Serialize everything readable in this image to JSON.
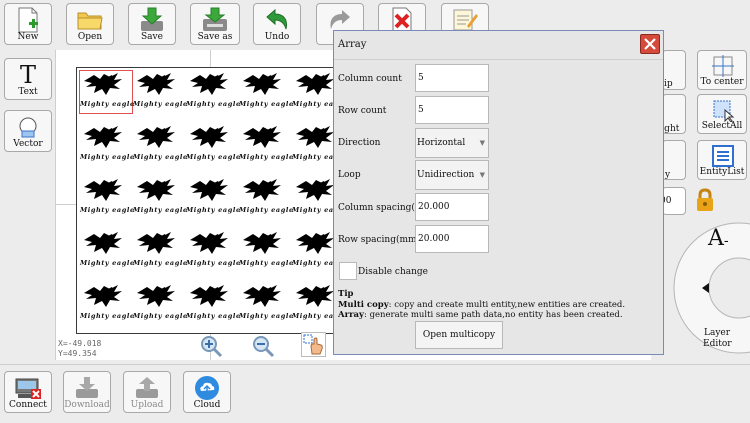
{
  "toolbar": {
    "new": "New",
    "open": "Open",
    "save": "Save",
    "save_as": "Save as",
    "undo": "Undo"
  },
  "left_tools": {
    "text": "Text",
    "vector": "Vector"
  },
  "right_tools": {
    "flip_partial": "ip",
    "to_center": "To center",
    "right_partial": "right",
    "select_all": "SelectAll",
    "y_partial": "y",
    "entity_list": "EntityList",
    "zero_partial": "00",
    "layer_editor_line1": "Layer",
    "layer_editor_line2": "Editor",
    "text_style_glyph": "A"
  },
  "coords": {
    "x": "X=-49.018",
    "y": "Y=49.354"
  },
  "design": {
    "caption": "Mighty eagle",
    "rows": 5,
    "cols": 5
  },
  "dialog": {
    "title": "Array",
    "column_count_label": "Column count",
    "column_count_value": "5",
    "row_count_label": "Row count",
    "row_count_value": "5",
    "direction_label": "Direction",
    "direction_value": "Horizontal",
    "loop_label": "Loop",
    "loop_value": "Unidirection",
    "column_spacing_label": "Column spacing(mm)",
    "column_spacing_value": "20.000",
    "row_spacing_label": "Row spacing(mm)",
    "row_spacing_value": "20.000",
    "disable_change_label": "Disable change",
    "tip_title": "Tip",
    "tip_multi_label": "Multi copy",
    "tip_multi_text": ": copy and create multi entity,new entities are created.",
    "tip_array_label": "Array",
    "tip_array_text": ": generate multi same path data,no entity has been created.",
    "open_multicopy": "Open multicopy"
  },
  "bottom": {
    "connect": "Connect",
    "download": "Download",
    "upload": "Upload",
    "cloud": "Cloud"
  },
  "colors": {
    "accent_red": "#d64a3c",
    "lock": "#e8a317",
    "entity_blue": "#2f6fd0"
  }
}
